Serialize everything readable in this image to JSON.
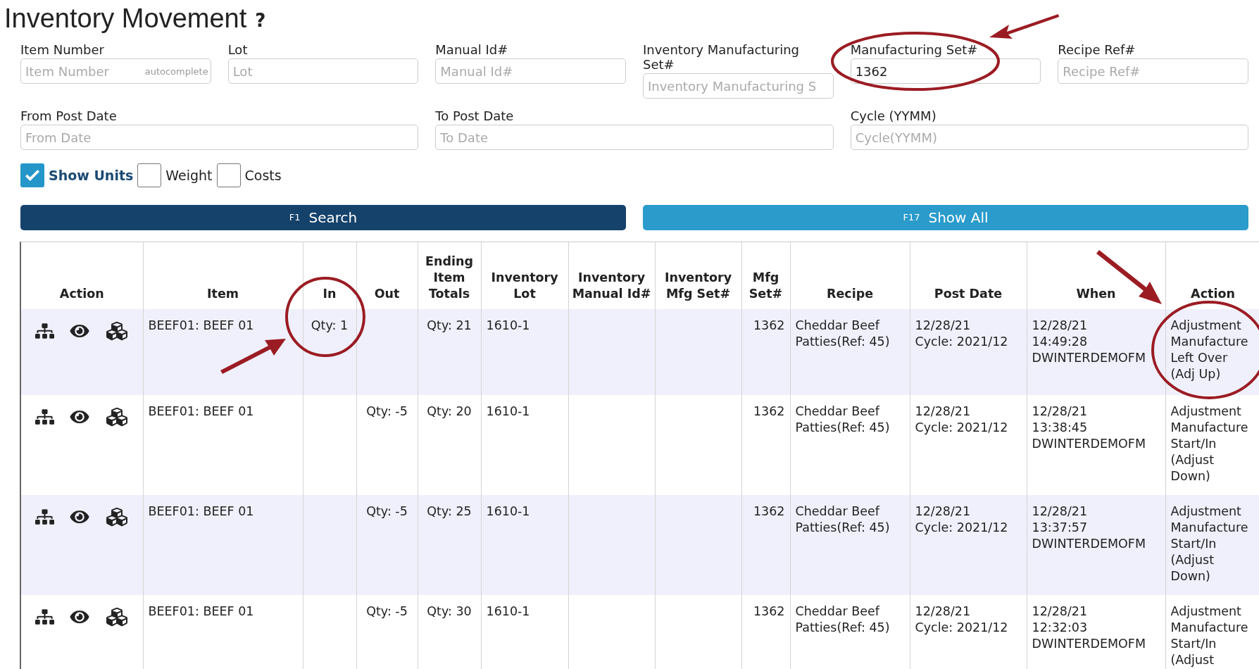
{
  "page": {
    "title": "Inventory Movement",
    "help": "?"
  },
  "fields": [
    {
      "label": "Item Number",
      "placeholder": "Item Number",
      "hint": "autocomplete"
    },
    {
      "label": "Lot",
      "placeholder": "Lot"
    },
    {
      "label": "Manual Id#",
      "placeholder": "Manual Id#"
    },
    {
      "label": "Inventory Manufacturing Set#",
      "placeholder": "Inventory Manufacturing S"
    },
    {
      "label": "Manufacturing Set#",
      "value": "1362"
    },
    {
      "label": "Recipe Ref#",
      "placeholder": "Recipe Ref#"
    },
    {
      "label": "From Post Date",
      "placeholder": "From Date"
    },
    {
      "label": "To Post Date",
      "placeholder": "To Date"
    },
    {
      "label": "Cycle (YYMM)",
      "placeholder": "Cycle(YYMM)"
    }
  ],
  "options": [
    {
      "label": "Show Units",
      "checked": true
    },
    {
      "label": "Weight",
      "checked": false
    },
    {
      "label": "Costs",
      "checked": false
    }
  ],
  "buttons": [
    {
      "key": "F1",
      "label": "Search",
      "kind": "primary"
    },
    {
      "key": "F17",
      "label": "Show All",
      "kind": "secondary"
    }
  ],
  "table": {
    "columns": [
      "Action",
      "Item",
      "In",
      "Out",
      "Ending Item Totals",
      "Inventory Lot",
      "Inventory Manual Id#",
      "Inventory Mfg Set#",
      "Mfg Set#",
      "Recipe",
      "Post Date",
      "When",
      "Action"
    ],
    "rows": [
      {
        "item": "BEEF01: BEEF 01",
        "in": "Qty: 1",
        "out": "",
        "total": "Qty: 21",
        "lot": "1610-1",
        "mfg_set": "1362",
        "recipe": "Cheddar Beef\nPatties(Ref: 45)",
        "post_date": "12/28/21\nCycle: 2021/12",
        "when": "12/28/21\n14:49:28\nDWINTERDEMOFM",
        "action": "Adjustment Manufacture Left Over (Adj Up)"
      },
      {
        "item": "BEEF01: BEEF 01",
        "in": "",
        "out": "Qty: -5",
        "total": "Qty: 20",
        "lot": "1610-1",
        "mfg_set": "1362",
        "recipe": "Cheddar Beef\nPatties(Ref: 45)",
        "post_date": "12/28/21\nCycle: 2021/12",
        "when": "12/28/21\n13:38:45\nDWINTERDEMOFM",
        "action": "Adjustment Manufacture Start/In (Adjust Down)"
      },
      {
        "item": "BEEF01: BEEF 01",
        "in": "",
        "out": "Qty: -5",
        "total": "Qty: 25",
        "lot": "1610-1",
        "mfg_set": "1362",
        "recipe": "Cheddar Beef\nPatties(Ref: 45)",
        "post_date": "12/28/21\nCycle: 2021/12",
        "when": "12/28/21\n13:37:57\nDWINTERDEMOFM",
        "action": "Adjustment Manufacture Start/In (Adjust Down)"
      },
      {
        "item": "BEEF01: BEEF 01",
        "in": "",
        "out": "Qty: -5",
        "total": "Qty: 30",
        "lot": "1610-1",
        "mfg_set": "1362",
        "recipe": "Cheddar Beef\nPatties(Ref: 45)",
        "post_date": "12/28/21\nCycle: 2021/12",
        "when": "12/28/21\n12:32:03\nDWINTERDEMOFM",
        "action": "Adjustment Manufacture Start/In (Adjust"
      }
    ]
  }
}
